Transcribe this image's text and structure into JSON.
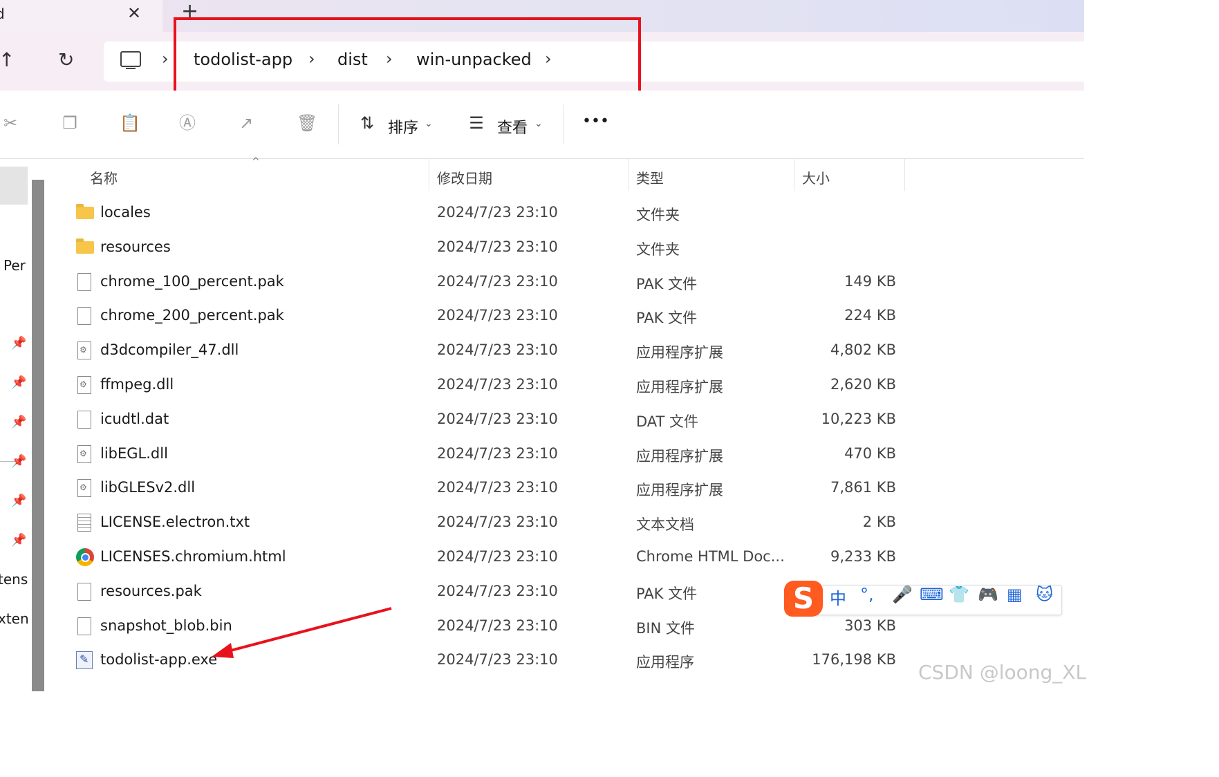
{
  "tab": {
    "title": "d",
    "close": "✕",
    "new": "+"
  },
  "nav": {
    "up": "↑",
    "refresh": "↻",
    "sep": "›"
  },
  "breadcrumb": [
    "todolist-app",
    "dist",
    "win-unpacked"
  ],
  "toolbar": {
    "sort_label": "排序",
    "view_label": "查看",
    "more": "•••",
    "chevron": "⌄"
  },
  "left_pane": {
    "labels": [
      "Per",
      "tens",
      "xten"
    ]
  },
  "columns": {
    "name": "名称",
    "date": "修改日期",
    "type": "类型",
    "size": "大小"
  },
  "files": [
    {
      "name": "locales",
      "date": "2024/7/23 23:10",
      "type": "文件夹",
      "size": "",
      "icon": "folder-icon"
    },
    {
      "name": "resources",
      "date": "2024/7/23 23:10",
      "type": "文件夹",
      "size": "",
      "icon": "folder-icon"
    },
    {
      "name": "chrome_100_percent.pak",
      "date": "2024/7/23 23:10",
      "type": "PAK 文件",
      "size": "149 KB",
      "icon": "file-icon"
    },
    {
      "name": "chrome_200_percent.pak",
      "date": "2024/7/23 23:10",
      "type": "PAK 文件",
      "size": "224 KB",
      "icon": "file-icon"
    },
    {
      "name": "d3dcompiler_47.dll",
      "date": "2024/7/23 23:10",
      "type": "应用程序扩展",
      "size": "4,802 KB",
      "icon": "dll-icon"
    },
    {
      "name": "ffmpeg.dll",
      "date": "2024/7/23 23:10",
      "type": "应用程序扩展",
      "size": "2,620 KB",
      "icon": "dll-icon"
    },
    {
      "name": "icudtl.dat",
      "date": "2024/7/23 23:10",
      "type": "DAT 文件",
      "size": "10,223 KB",
      "icon": "file-icon"
    },
    {
      "name": "libEGL.dll",
      "date": "2024/7/23 23:10",
      "type": "应用程序扩展",
      "size": "470 KB",
      "icon": "dll-icon"
    },
    {
      "name": "libGLESv2.dll",
      "date": "2024/7/23 23:10",
      "type": "应用程序扩展",
      "size": "7,861 KB",
      "icon": "dll-icon"
    },
    {
      "name": "LICENSE.electron.txt",
      "date": "2024/7/23 23:10",
      "type": "文本文档",
      "size": "2 KB",
      "icon": "text-file-icon"
    },
    {
      "name": "LICENSES.chromium.html",
      "date": "2024/7/23 23:10",
      "type": "Chrome HTML Doc...",
      "size": "9,233 KB",
      "icon": "chrome-icon"
    },
    {
      "name": "resources.pak",
      "date": "2024/7/23 23:10",
      "type": "PAK 文件",
      "size": "",
      "icon": "file-icon"
    },
    {
      "name": "snapshot_blob.bin",
      "date": "2024/7/23 23:10",
      "type": "BIN 文件",
      "size": "303 KB",
      "icon": "file-icon"
    },
    {
      "name": "todolist-app.exe",
      "date": "2024/7/23 23:10",
      "type": "应用程序",
      "size": "176,198 KB",
      "icon": "exe-icon"
    }
  ],
  "ime": {
    "logo": "S",
    "lang": "中",
    "punct": "°,",
    "items": [
      "mic-icon",
      "keyboard-icon",
      "skin-icon",
      "game-icon",
      "apps-icon",
      "cat-icon"
    ]
  },
  "watermark": "CSDN @loong_XL",
  "colors": {
    "highlight": "#e8121c",
    "arrow": "#e8121c",
    "ime_accent": "#1f66d6",
    "ime_logo": "#ff5a1f"
  }
}
